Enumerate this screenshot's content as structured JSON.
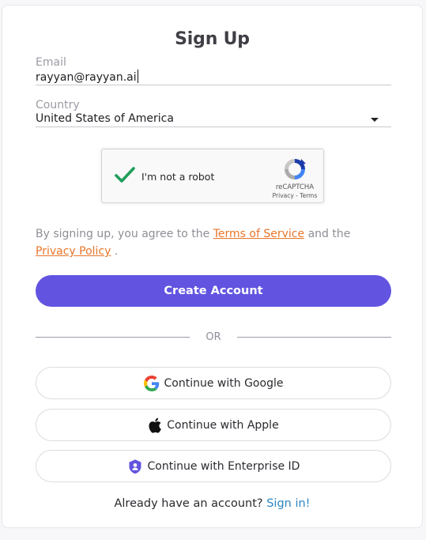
{
  "form": {
    "title": "Sign Up",
    "email_label": "Email",
    "email_value": "rayyan@rayyan.ai",
    "country_label": "Country",
    "country_value": "United States of America"
  },
  "recaptcha": {
    "label": "I'm not a robot",
    "brand": "reCAPTCHA",
    "links": "Privacy - Terms",
    "checked": true
  },
  "terms": {
    "prefix": "By signing up, you agree to the ",
    "terms_link": "Terms of Service",
    "middle": " and the",
    "privacy_link": "Privacy Policy",
    "suffix": " ."
  },
  "actions": {
    "create_account": "Create Account",
    "divider": "OR",
    "google": "Continue with Google",
    "apple": "Continue with Apple",
    "enterprise": "Continue with Enterprise ID"
  },
  "footer": {
    "prompt": "Already have an account?",
    "signin": "Sign in!"
  },
  "colors": {
    "primary": "#6254e0",
    "link_orange": "#e8752a",
    "link_blue": "#2e86c1",
    "check_green": "#1e9e5a"
  },
  "icons": {
    "google": "google-icon",
    "apple": "apple-icon",
    "enterprise": "shield-person-icon",
    "dropdown": "chevron-down-icon"
  }
}
